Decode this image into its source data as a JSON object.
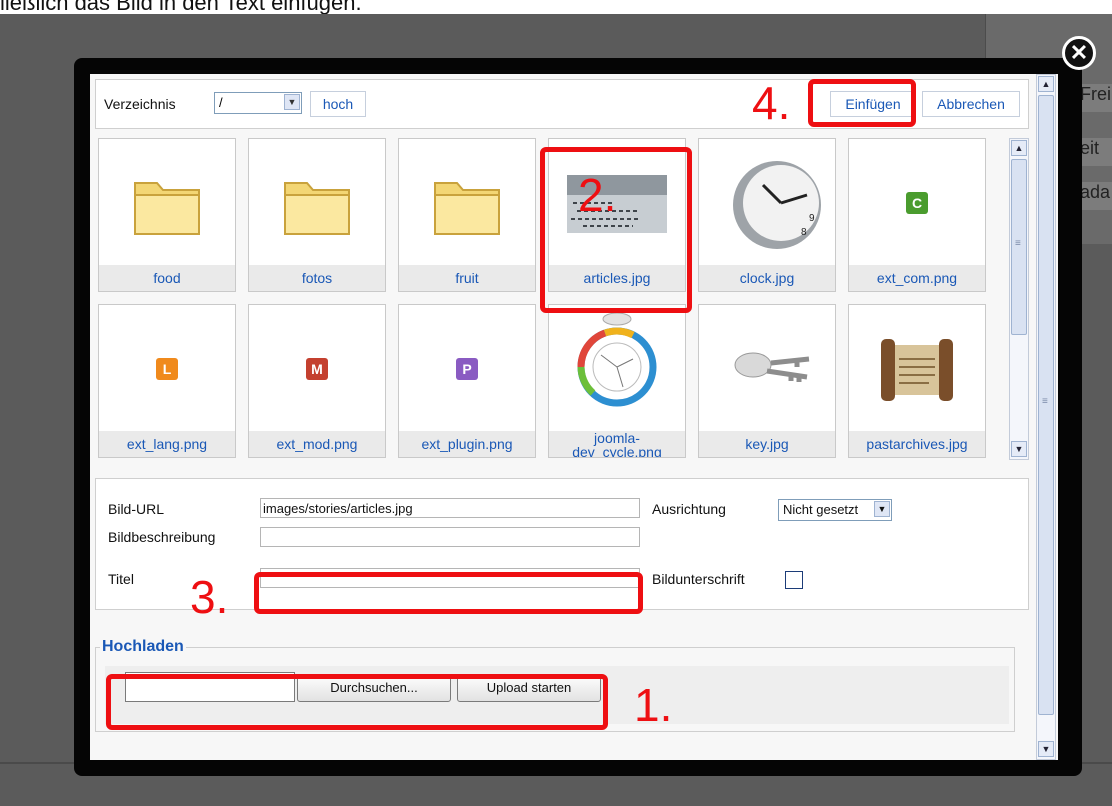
{
  "caption": "ließlich das Bild in den Text einfügen.",
  "background": {
    "panel_rows": [
      "Frei",
      "eit",
      "ada"
    ]
  },
  "toolbar": {
    "dir_label": "Verzeichnis",
    "dir_value": "/",
    "up_button": "hoch",
    "insert_button": "Einfügen",
    "cancel_button": "Abbrechen"
  },
  "gallery": {
    "items": [
      {
        "name": "food",
        "icon": "folder-icon"
      },
      {
        "name": "fotos",
        "icon": "folder-icon"
      },
      {
        "name": "fruit",
        "icon": "folder-icon"
      },
      {
        "name": "articles.jpg",
        "icon": "photo-thumbnail"
      },
      {
        "name": "clock.jpg",
        "icon": "clock-thumbnail"
      },
      {
        "name": "ext_com.png",
        "icon": "badge-c",
        "badge": "C",
        "color": "#4a9c2e"
      },
      {
        "name": "ext_lang.png",
        "icon": "badge-l",
        "badge": "L",
        "color": "#f08a1c"
      },
      {
        "name": "ext_mod.png",
        "icon": "badge-m",
        "badge": "M",
        "color": "#c4402f"
      },
      {
        "name": "ext_plugin.png",
        "icon": "badge-p",
        "badge": "P",
        "color": "#8a5bc2"
      },
      {
        "name": "joomla-dev_cycle.png",
        "name_line1": "joomla-",
        "name_line2": "dev_cycle.png",
        "icon": "cycle-diagram-thumbnail"
      },
      {
        "name": "key.jpg",
        "icon": "keys-thumbnail"
      },
      {
        "name": "pastarchives.jpg",
        "icon": "scroll-thumbnail"
      }
    ]
  },
  "form": {
    "url_label": "Bild-URL",
    "url_value": "images/stories/articles.jpg",
    "desc_label": "Bildbeschreibung",
    "desc_value": "",
    "title_label": "Titel",
    "title_value": "",
    "align_label": "Ausrichtung",
    "align_value": "Nicht gesetzt",
    "caption_label": "Bildunterschrift",
    "caption_checked": false
  },
  "upload": {
    "legend": "Hochladen",
    "browse_button": "Durchsuchen...",
    "start_button": "Upload starten"
  },
  "annotations": {
    "step1": "1.",
    "step2": "2.",
    "step3": "3.",
    "step4": "4.",
    "color": "#ee0f12"
  }
}
